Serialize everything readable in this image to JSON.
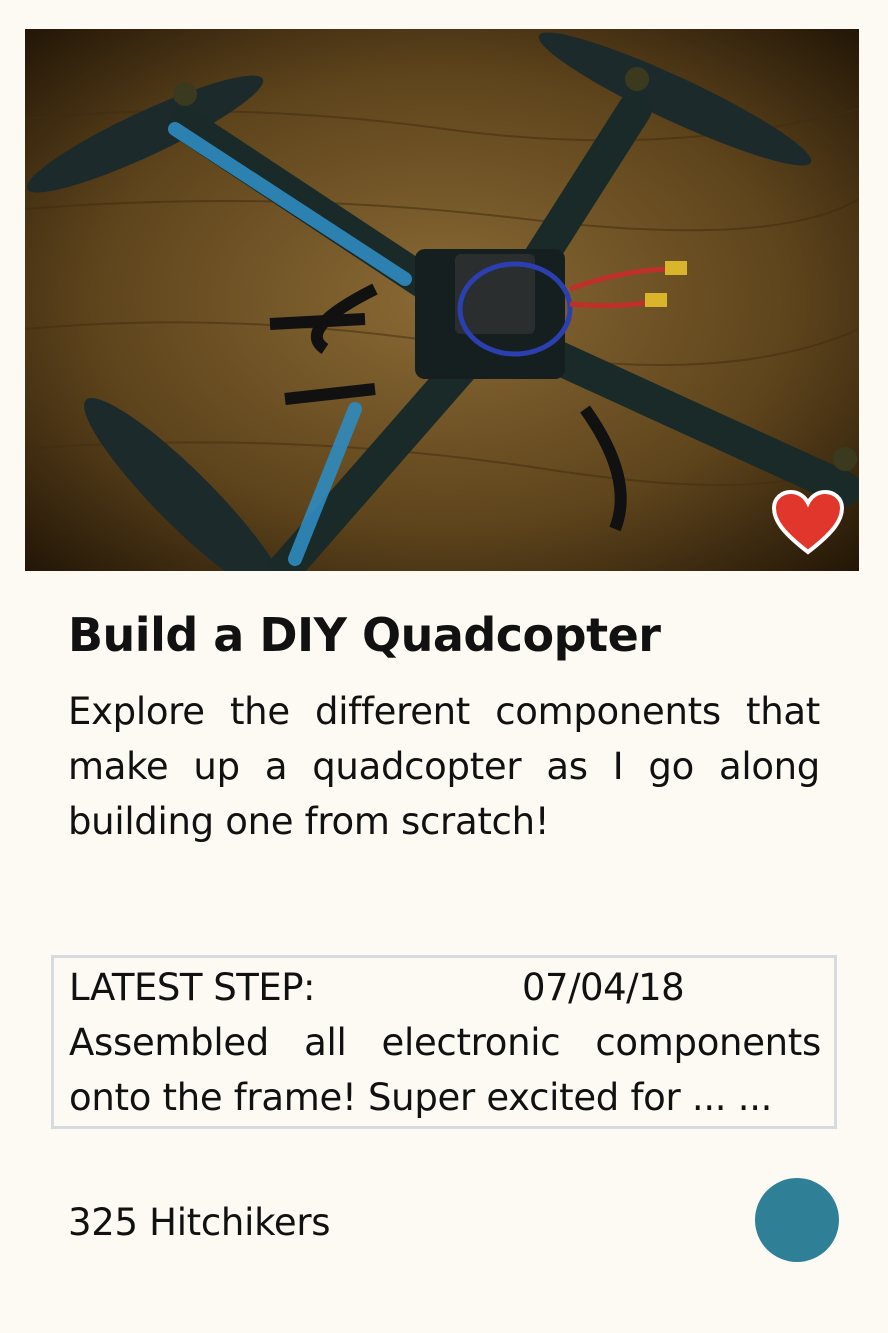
{
  "card": {
    "image_alt": "Quadcopter photo",
    "favorite_icon": "heart-icon",
    "favorite_color": "#e0362b",
    "title": "Build a DIY Quadcopter",
    "description": "Explore the different components that make up a quadcopter as I go along building one from scratch!",
    "latest_step": {
      "label": "LATEST STEP:",
      "date": "07/04/18",
      "text": "Assembled all electronic components onto the frame! Super excited for ... ..."
    },
    "followers": "325 Hitchikers",
    "follow_button_color": "#2f7f97"
  }
}
